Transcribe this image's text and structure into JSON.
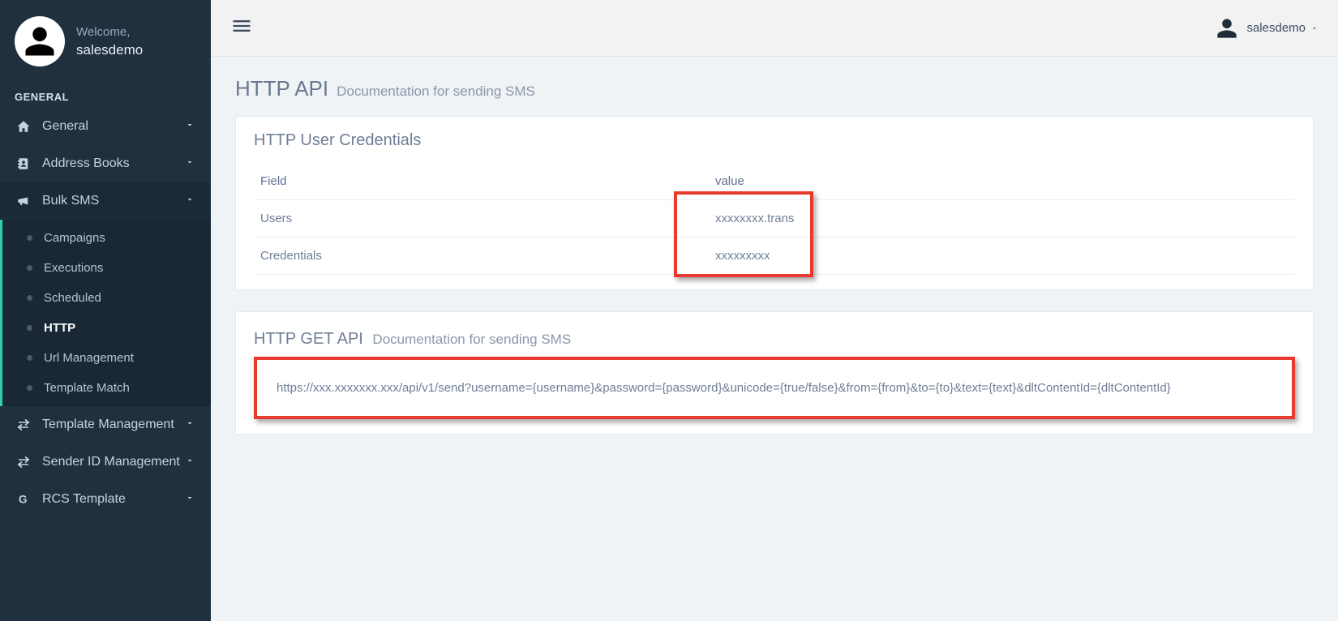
{
  "sidebar": {
    "welcome": "Welcome,",
    "username": "salesdemo",
    "section": "GENERAL",
    "items": [
      {
        "label": "General"
      },
      {
        "label": "Address Books"
      },
      {
        "label": "Bulk SMS"
      },
      {
        "label": "Template Management"
      },
      {
        "label": "Sender ID Management"
      },
      {
        "label": "RCS Template"
      }
    ],
    "bulk_sms_children": [
      {
        "label": "Campaigns"
      },
      {
        "label": "Executions"
      },
      {
        "label": "Scheduled"
      },
      {
        "label": "HTTP"
      },
      {
        "label": "Url Management"
      },
      {
        "label": "Template Match"
      }
    ]
  },
  "topbar": {
    "user": "salesdemo"
  },
  "page": {
    "title": "HTTP API",
    "subtitle": "Documentation for sending SMS"
  },
  "cred_panel": {
    "title": "HTTP User Credentials",
    "header_field": "Field",
    "header_value": "value",
    "rows": [
      {
        "field": "Users",
        "value": "xxxxxxxx.trans"
      },
      {
        "field": "Credentials",
        "value": "xxxxxxxxx"
      }
    ]
  },
  "get_panel": {
    "title": "HTTP GET API",
    "subtitle": "Documentation for sending SMS",
    "url": "https://xxx.xxxxxxx.xxx/api/v1/send?username={username}&password={password}&unicode={true/false}&from={from}&to={to}&text={text}&dltContentId={dltContentId}"
  }
}
